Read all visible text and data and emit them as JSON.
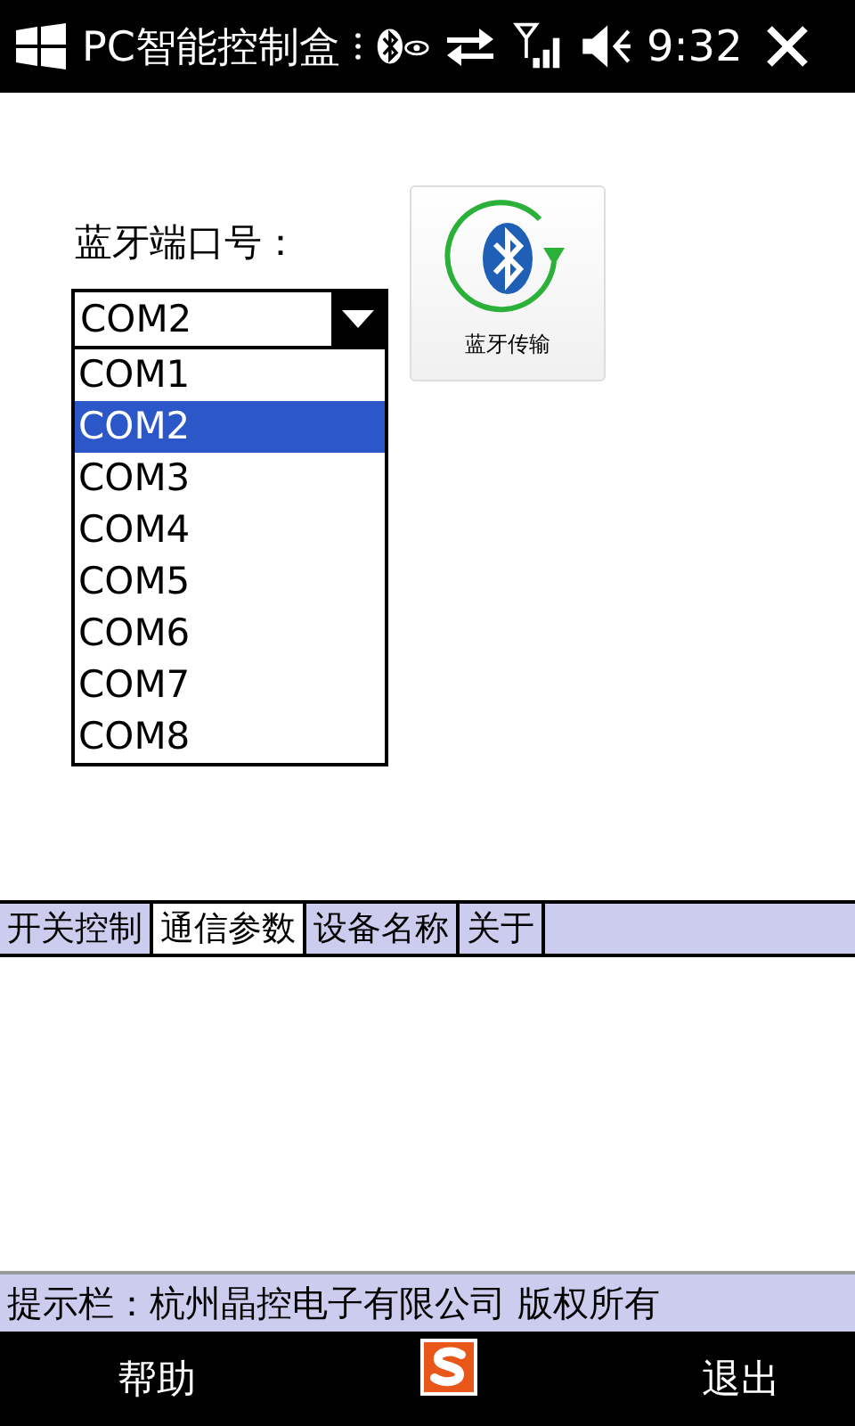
{
  "status_bar": {
    "title": "PC智能控制盒",
    "time": "9:32"
  },
  "port": {
    "label": "蓝牙端口号：",
    "value": "COM2",
    "expanded": true,
    "options": [
      {
        "label": "COM1",
        "selected": false
      },
      {
        "label": "COM2",
        "selected": true
      },
      {
        "label": "COM3",
        "selected": false
      },
      {
        "label": "COM4",
        "selected": false
      },
      {
        "label": "COM5",
        "selected": false
      },
      {
        "label": "COM6",
        "selected": false
      },
      {
        "label": "COM7",
        "selected": false
      },
      {
        "label": "COM8",
        "selected": false
      }
    ]
  },
  "transfer_button": {
    "label": "蓝牙传输"
  },
  "tabs": [
    {
      "label": "开关控制",
      "selected": false
    },
    {
      "label": "通信参数",
      "selected": true
    },
    {
      "label": "设备名称",
      "selected": false
    },
    {
      "label": "关于",
      "selected": false
    }
  ],
  "hint_bar": "提示栏：杭州晶控电子有限公司 版权所有",
  "menu": {
    "left": "帮助",
    "right": "退出"
  }
}
